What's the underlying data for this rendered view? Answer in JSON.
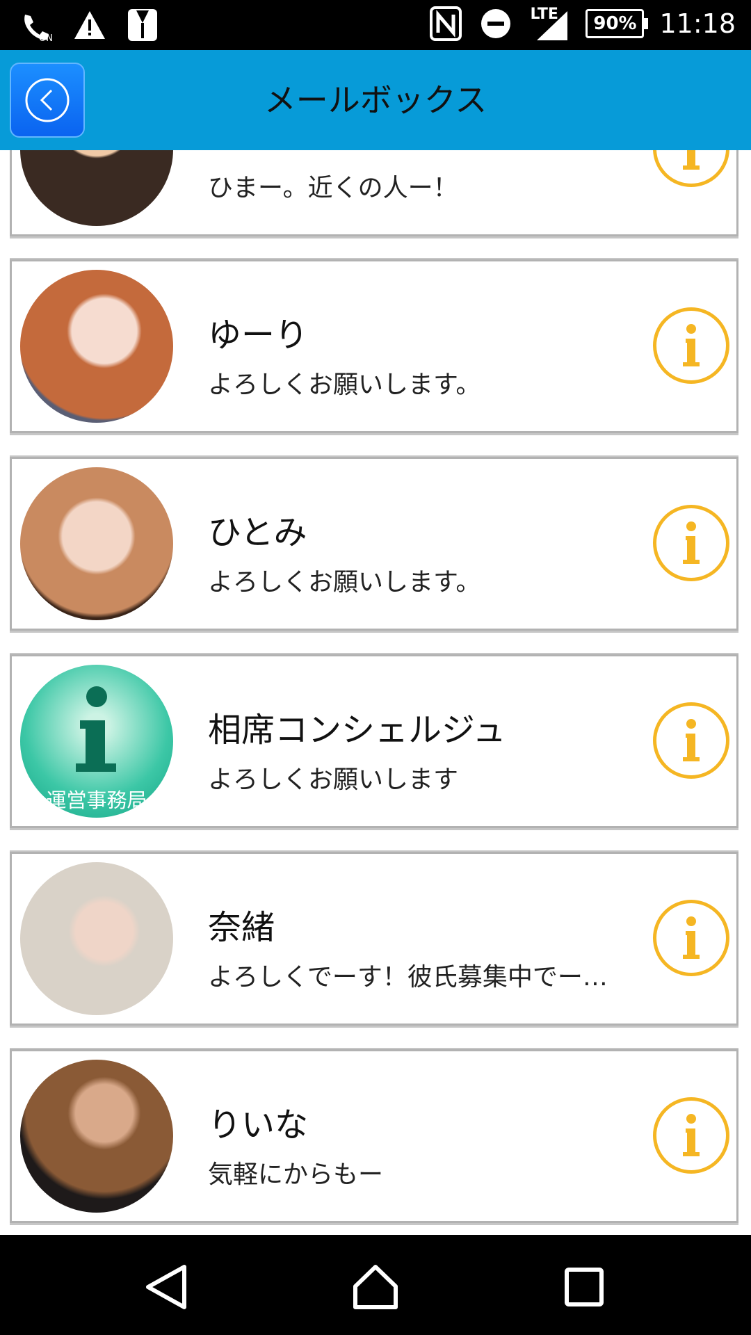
{
  "status_bar": {
    "left_icons": [
      "nfc-call-icon",
      "warning-icon",
      "tuxedo-icon"
    ],
    "right_icons": [
      "nfc-icon",
      "do-not-disturb-icon",
      "lte-signal-icon"
    ],
    "lte": "LTE",
    "battery": "90%",
    "time": "11:18"
  },
  "header": {
    "back_icon": "chevron-left-icon",
    "title": "メールボックス"
  },
  "messages": [
    {
      "name": "",
      "message": "ひまー。近くの人ー！",
      "avatar": "photo"
    },
    {
      "name": "ゆーり",
      "message": "よろしくお願いします。",
      "avatar": "photo"
    },
    {
      "name": "ひとみ",
      "message": "よろしくお願いします。",
      "avatar": "photo"
    },
    {
      "name": "相席コンシェルジュ",
      "message": "よろしくお願いします",
      "avatar": "info-logo",
      "avatar_caption": "運営事務局"
    },
    {
      "name": "奈緒",
      "message": "よろしくでーす！彼氏募集中でー…",
      "avatar": "photo"
    },
    {
      "name": "りいな",
      "message": "気軽にからもー",
      "avatar": "photo"
    }
  ],
  "nav": {
    "icons": [
      "back-triangle-icon",
      "home-icon",
      "recents-icon"
    ]
  },
  "colors": {
    "header": "#079bd8",
    "info_accent": "#f5b623",
    "card_border": "#b2b2b2"
  }
}
